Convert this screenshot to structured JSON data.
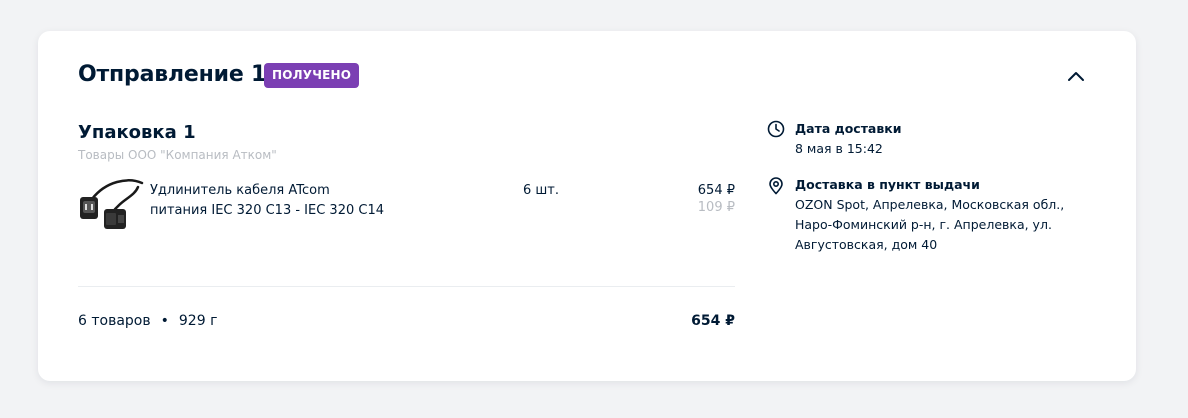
{
  "shipment": {
    "title": "Отправление 1",
    "status": "ПОЛУЧЕНО",
    "status_color": "#7b3fb3"
  },
  "package": {
    "title": "Упаковка 1",
    "seller": "Товары ООО \"Компания Атком\""
  },
  "items": [
    {
      "name": "Удлинитель кабеля ATcom питания IEC 320 C13 - IEC 320 C14",
      "quantity": "6 шт.",
      "price": "654 ₽",
      "unit_price": "109 ₽",
      "image": "power-cable-icon"
    }
  ],
  "summary": {
    "count": "6 товаров",
    "separator": "•",
    "weight": "929 г",
    "total": "654 ₽"
  },
  "delivery": {
    "date_label": "Дата доставки",
    "date_value": "8 мая в 15:42",
    "date_icon": "clock-icon",
    "place_label": "Доставка в пункт выдачи",
    "place_value": "OZON Spot, Апрелевка, Московская обл., Наро-Фоминский р-н, г. Апрелевка, ул. Августовская, дом 40",
    "place_icon": "location-pin-icon"
  },
  "controls": {
    "collapse_icon": "chevron-up-icon"
  }
}
